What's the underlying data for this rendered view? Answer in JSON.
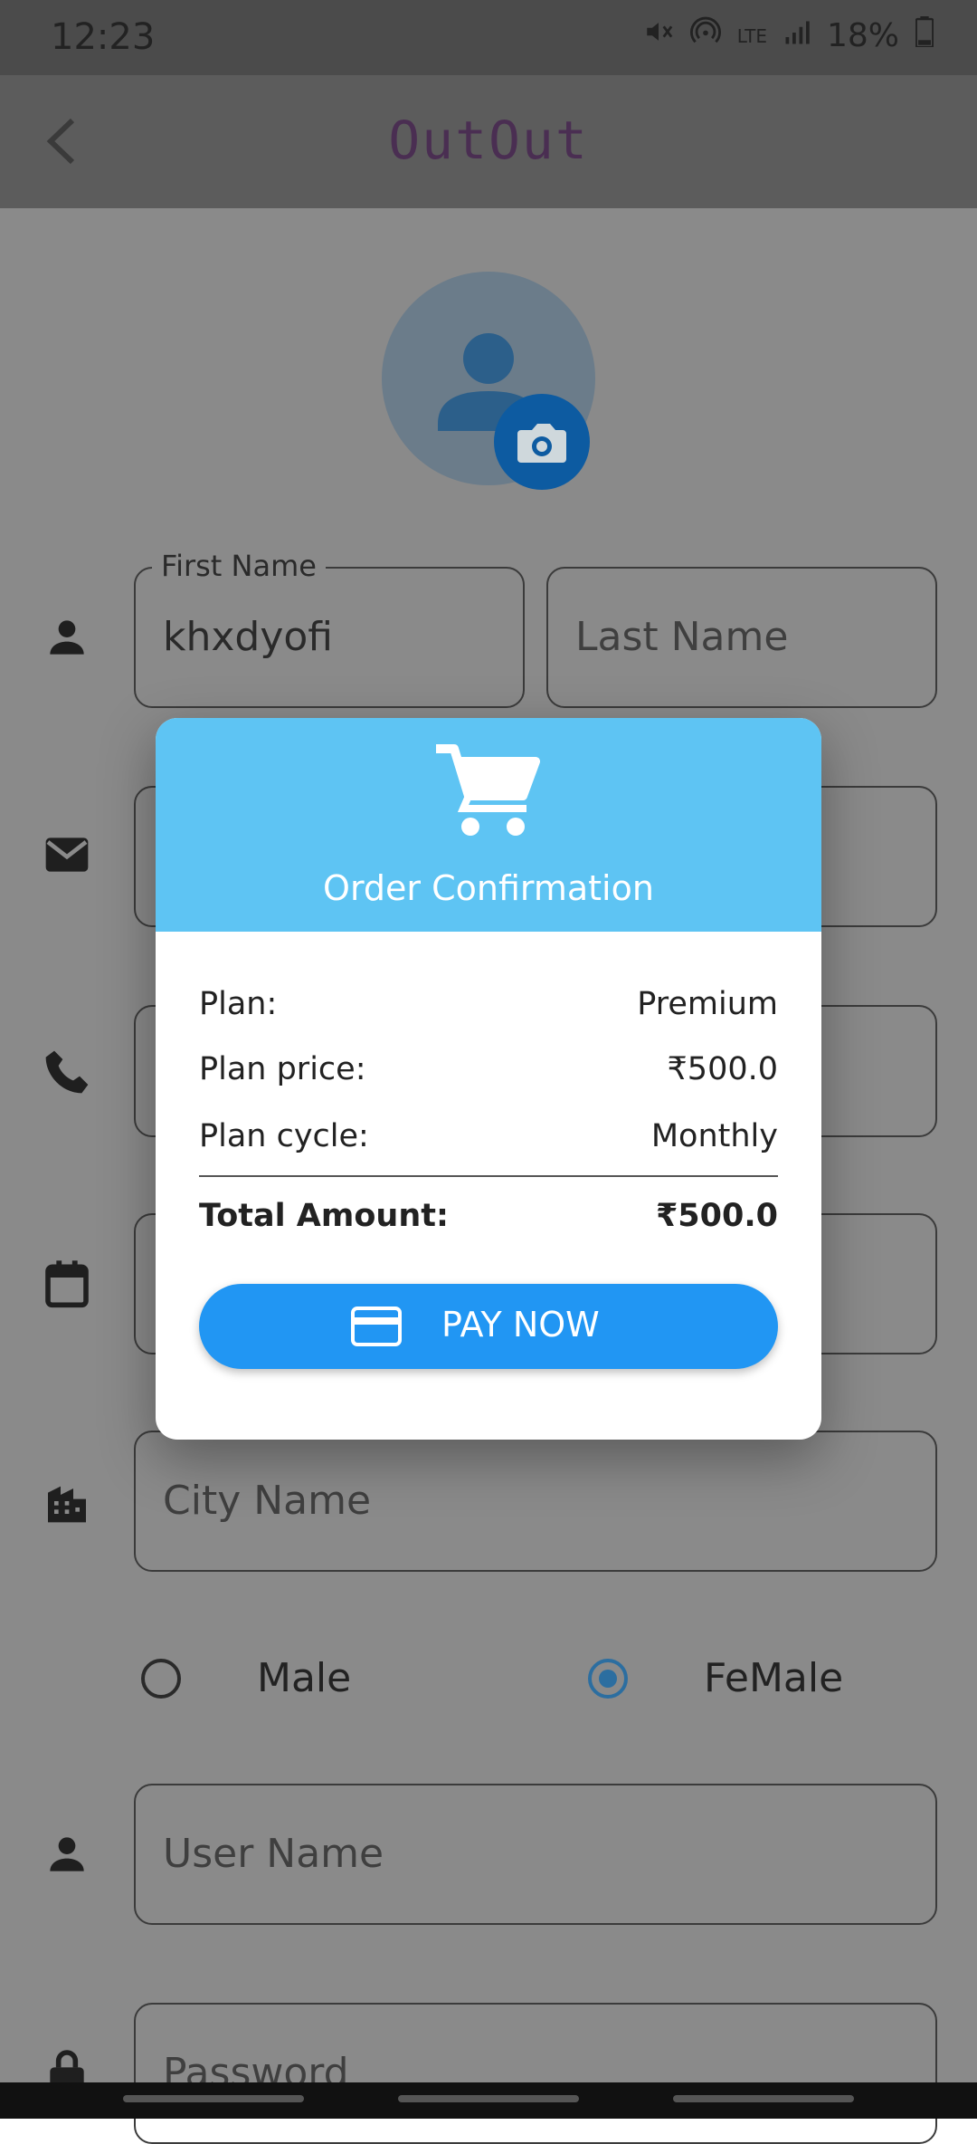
{
  "status_bar": {
    "time": "12:23",
    "battery": "18%",
    "network": "LTE",
    "icons": [
      "mute-icon",
      "hotspot-icon",
      "volte-icon",
      "signal-icon",
      "battery-icon"
    ]
  },
  "app_bar": {
    "title": "OutOut",
    "back_icon": "back-arrow-icon"
  },
  "form": {
    "first_name_label": "First Name",
    "first_name_value": "khxdyofi",
    "last_name_placeholder": "Last Name",
    "city_placeholder": "City Name",
    "gender_options": [
      "Male",
      "FeMale"
    ],
    "gender_selected": "FeMale",
    "username_placeholder": "User Name",
    "password_placeholder": "Password"
  },
  "dialog": {
    "title": "Order Confirmation",
    "icon": "shopping-cart-icon",
    "rows": [
      {
        "label": "Plan:",
        "value": "Premium"
      },
      {
        "label": "Plan price:",
        "value": "₹500.0"
      },
      {
        "label": "Plan cycle:",
        "value": "Monthly"
      }
    ],
    "total_label": "Total Amount:",
    "total_value": "₹500.0",
    "pay_button": "PAY NOW",
    "pay_icon": "credit-card-icon"
  },
  "colors": {
    "dialog_header": "#5ec4f3",
    "pay_button": "#2196f3",
    "accent_radio": "#2c6ea0"
  }
}
